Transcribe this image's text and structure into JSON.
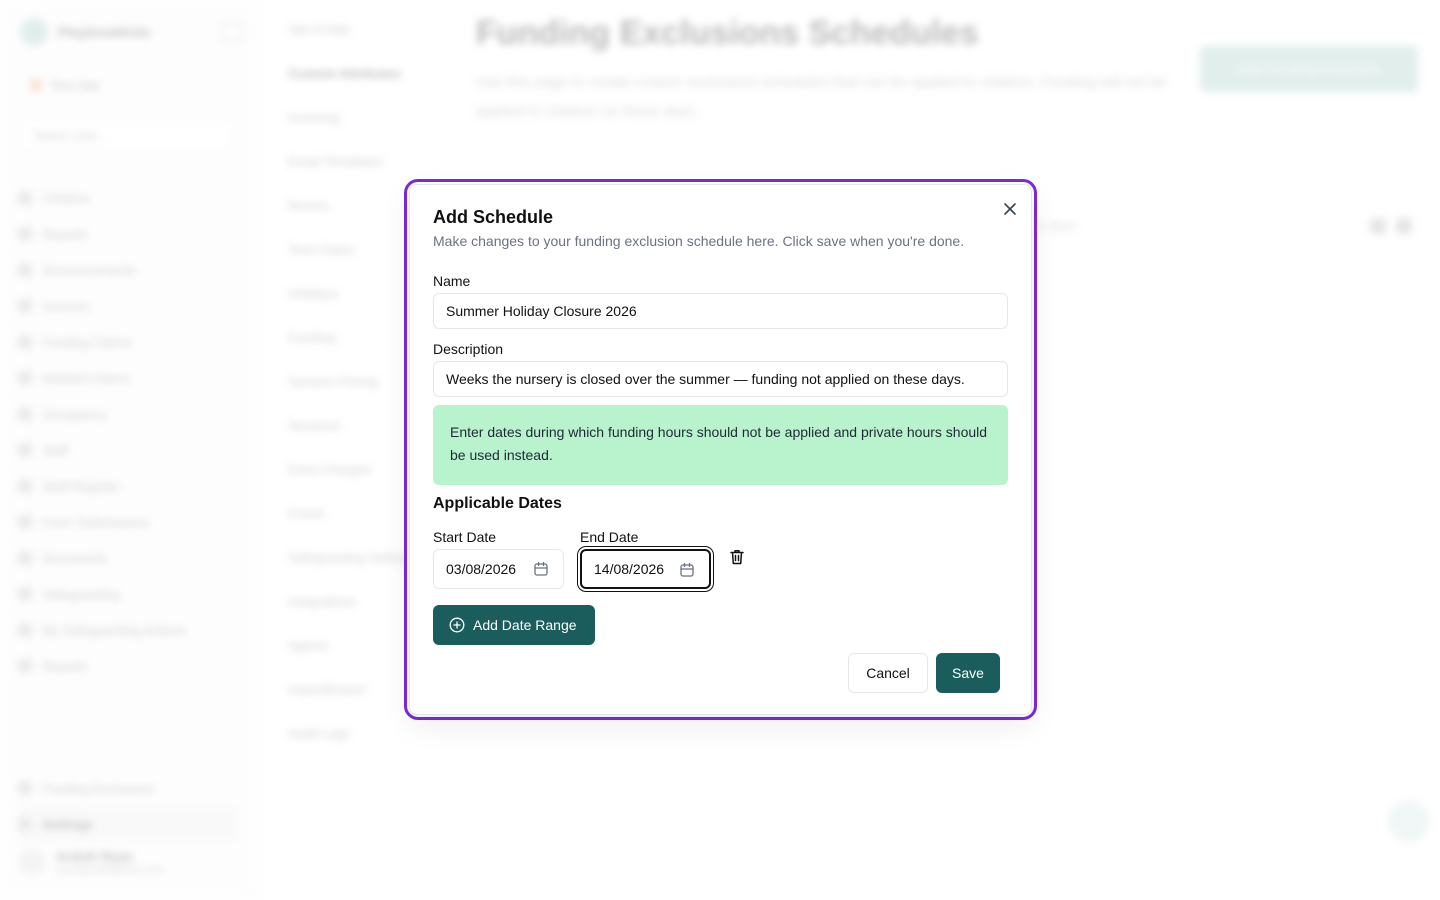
{
  "background": {
    "brand": {
      "name": "PlaybookKids"
    },
    "site_select": {
      "value": "Test Site"
    },
    "unit_select": {
      "placeholder": "Select Unit..."
    },
    "sidebar_items": [
      {
        "label": "Children"
      },
      {
        "label": "Reports"
      },
      {
        "label": "Announcements"
      },
      {
        "label": "Invoices"
      },
      {
        "label": "Funding Claims"
      },
      {
        "label": "Deleted Claims"
      },
      {
        "label": "Occupancy"
      },
      {
        "label": "Staff"
      },
      {
        "label": "Staff Register"
      },
      {
        "label": "Form Submissions"
      },
      {
        "label": "Documents"
      },
      {
        "label": "Safeguarding"
      },
      {
        "label": "My Safeguarding Actions"
      },
      {
        "label": "Reports"
      }
    ],
    "sidebar_bottom": [
      {
        "label": "Funding Exclusions"
      },
      {
        "label": "Settings"
      }
    ],
    "user": {
      "name": "Ardeth Ryan",
      "email": "ryan@child@test.com"
    },
    "settings_nav": [
      {
        "label": "Site Profile"
      },
      {
        "label": "Custom Attributes"
      },
      {
        "label": "Invoicing"
      },
      {
        "label": "Email Templates"
      },
      {
        "label": "Rooms"
      },
      {
        "label": "Term Dates"
      },
      {
        "label": "Holidays"
      },
      {
        "label": "Funding"
      },
      {
        "label": "Session Pricing"
      },
      {
        "label": "Sessions"
      },
      {
        "label": "Extra Charges"
      },
      {
        "label": "Forms"
      },
      {
        "label": "Safeguarding Settings"
      },
      {
        "label": "Integrations"
      },
      {
        "label": "Agents"
      },
      {
        "label": "Import/Export"
      },
      {
        "label": "Audit Logs"
      }
    ],
    "page_title": "Funding Exclusions Schedules",
    "page_description": "Use this page to create custom exclusions schedules that can be applied to children. Funding will not be applied to children on these days.",
    "add_button_label": "Add Funding Exclusion",
    "row_text": "no days"
  },
  "dialog": {
    "title": "Add Schedule",
    "description": "Make changes to your funding exclusion schedule here. Click save when you're done.",
    "name_label": "Name",
    "name_value": "Summer Holiday Closure 2026",
    "description_label": "Description",
    "description_value": "Weeks the nursery is closed over the summer — funding not applied on these days.",
    "info_text": "Enter dates during which funding hours should not be applied and private hours should be used instead.",
    "applicable_dates_title": "Applicable Dates",
    "date_ranges": [
      {
        "start_label": "Start Date",
        "start_value": "03/08/2026",
        "end_label": "End Date",
        "end_value": "14/08/2026"
      }
    ],
    "add_range_label": "Add Date Range",
    "cancel_label": "Cancel",
    "save_label": "Save"
  },
  "colors": {
    "accent": "#1a5d5c",
    "info_bg": "#b8f3cd",
    "highlight_frame": "#7c2bd8"
  },
  "icons": [
    "close-icon",
    "calendar-icon",
    "trash-icon",
    "plus-circle-icon"
  ]
}
